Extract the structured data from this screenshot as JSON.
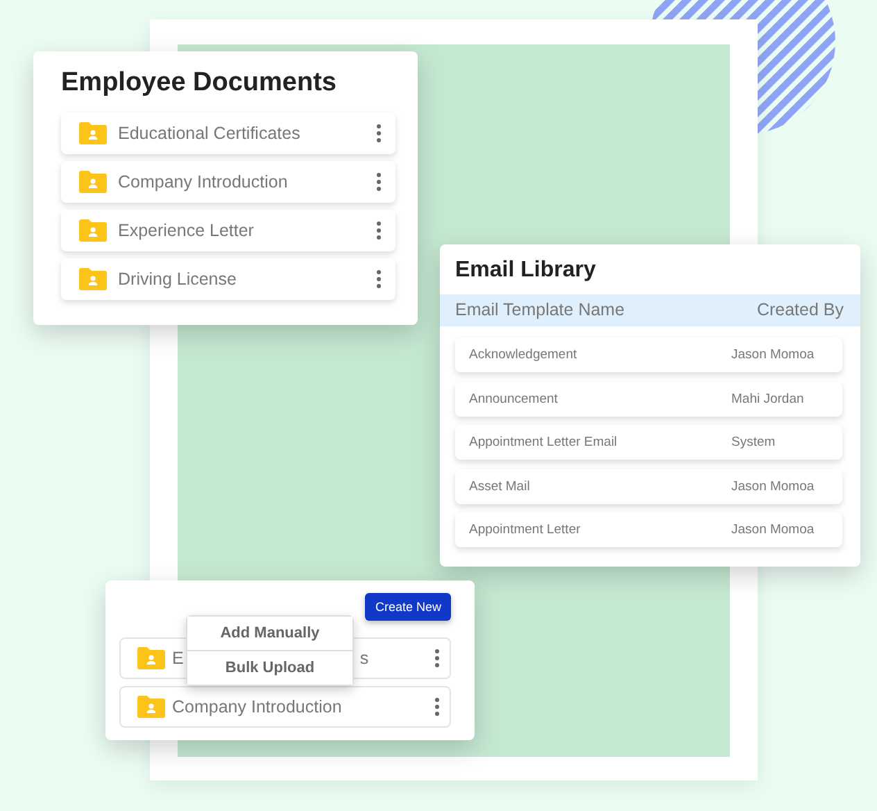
{
  "employee_documents": {
    "title": "Employee Documents",
    "items": [
      {
        "label": "Educational Certificates"
      },
      {
        "label": "Company Introduction"
      },
      {
        "label": "Experience Letter"
      },
      {
        "label": "Driving License"
      }
    ]
  },
  "email_library": {
    "title": "Email Library",
    "columns": [
      "Email Template Name",
      "Created By"
    ],
    "rows": [
      {
        "name": "Acknowledgement",
        "created_by": "Jason Momoa"
      },
      {
        "name": "Announcement",
        "created_by": "Mahi Jordan"
      },
      {
        "name": "Appointment Letter Email",
        "created_by": "System"
      },
      {
        "name": "Asset Mail",
        "created_by": "Jason Momoa"
      },
      {
        "name": "Appointment Letter",
        "created_by": "Jason Momoa"
      }
    ]
  },
  "upload_card": {
    "button": "Create New",
    "menu": [
      "Add Manually",
      "Bulk Upload"
    ],
    "items": [
      {
        "label": "E",
        "label_tail": "s"
      },
      {
        "label": "Company Introduction"
      }
    ]
  }
}
